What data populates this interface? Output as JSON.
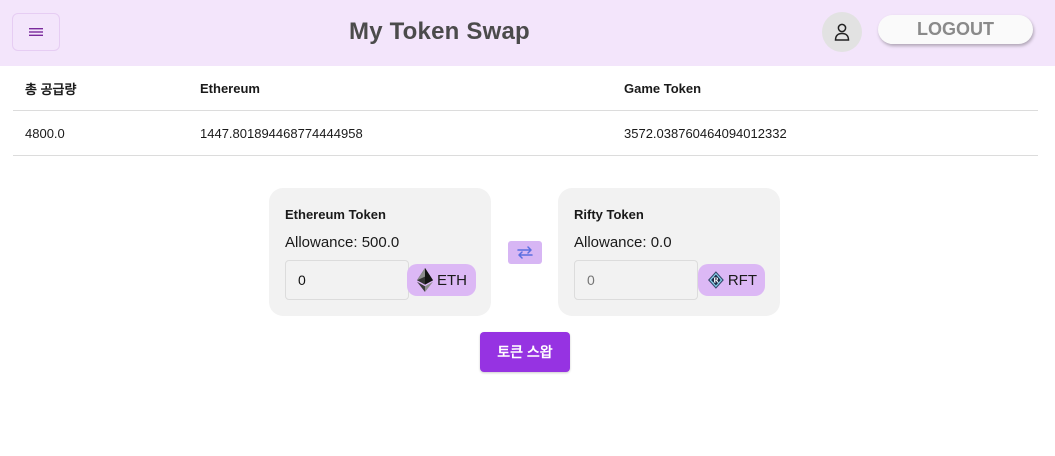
{
  "header": {
    "title": "My Token Swap",
    "logout_label": "LOGOUT",
    "menu_icon": "hamburger-icon",
    "user_icon": "user-icon"
  },
  "supply_table": {
    "headers": [
      "총 공급량",
      "Ethereum",
      "Game Token"
    ],
    "rows": [
      [
        "4800.0",
        "1447.801894468774444958",
        "3572.038760464094012332"
      ]
    ]
  },
  "swap": {
    "from_card": {
      "title": "Ethereum Token",
      "allowance": "Allowance: 500.0",
      "amount_value": "0",
      "token_label": "ETH",
      "token_icon": "ethereum-icon"
    },
    "to_card": {
      "title": "Rifty Token",
      "allowance": "Allowance: 0.0",
      "amount_placeholder": "0",
      "token_label": "RFT",
      "token_icon": "rifty-token-icon"
    },
    "switch_icon": "swap-arrows-icon",
    "submit_label": "토큰 스왑"
  },
  "colors": {
    "header_bg": "#f3e5fb",
    "card_bg": "#f2f2f2",
    "chip_bg": "#dcb8f5",
    "primary": "#9633e2"
  }
}
